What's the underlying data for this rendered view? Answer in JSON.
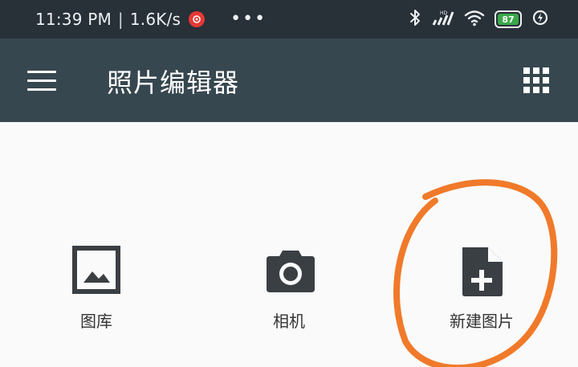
{
  "status_bar": {
    "time": "11:39 PM",
    "separator": "|",
    "network_speed": "1.6K/s",
    "more_dots": "•••",
    "battery_level": "87"
  },
  "app_bar": {
    "title": "照片编辑器"
  },
  "actions": [
    {
      "label": "图库",
      "icon": "gallery-icon"
    },
    {
      "label": "相机",
      "icon": "camera-icon"
    },
    {
      "label": "新建图片",
      "icon": "new-image-icon"
    }
  ],
  "colors": {
    "status_bar_bg": "#283038",
    "app_bar_bg": "#37474f",
    "content_bg": "#fafafa",
    "icon_color": "#3a3f44",
    "annotation_circle": "#f07a2a",
    "battery_fill": "#3aa84a"
  }
}
